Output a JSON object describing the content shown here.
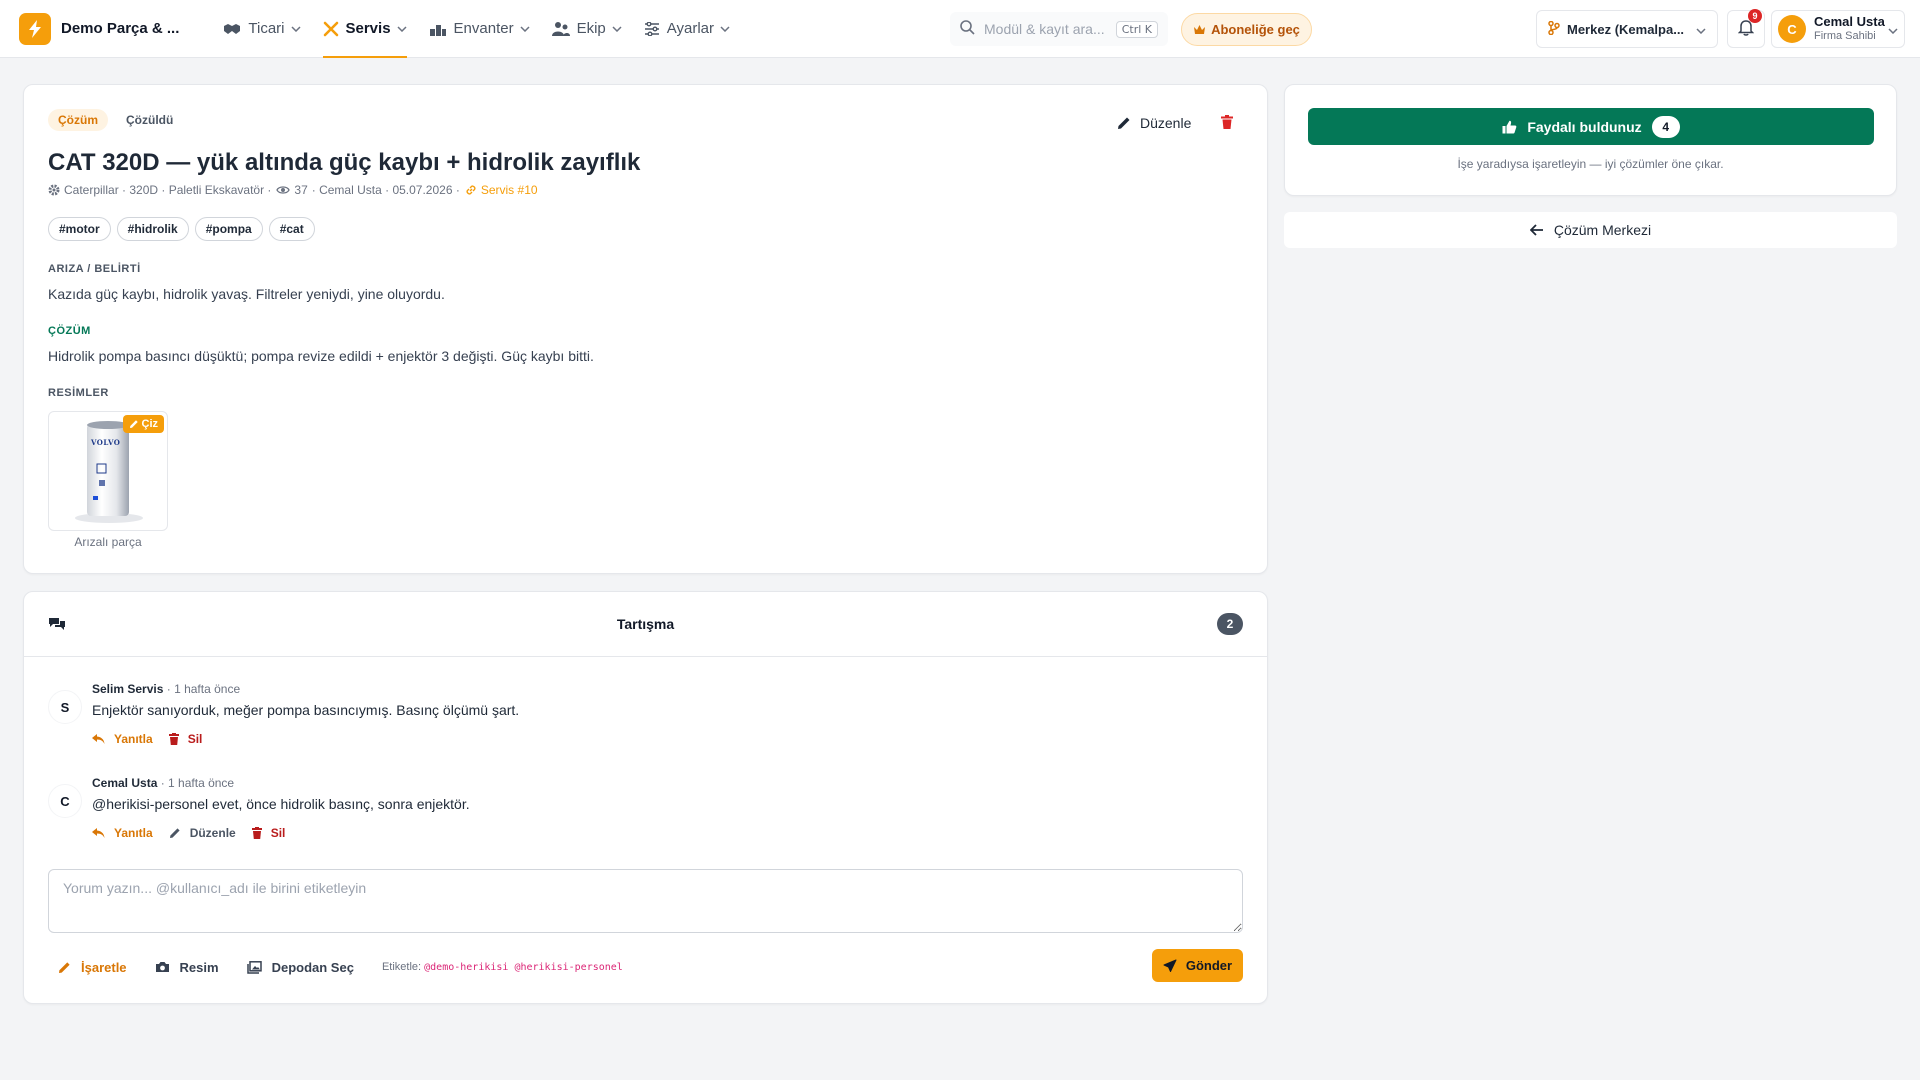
{
  "brand": {
    "name": "Demo Parça & ..."
  },
  "nav": {
    "items": [
      {
        "label": "Ticari",
        "icon": "handshake-icon"
      },
      {
        "label": "Servis",
        "icon": "tools-icon",
        "active": true
      },
      {
        "label": "Envanter",
        "icon": "warehouse-icon"
      },
      {
        "label": "Ekip",
        "icon": "users-icon"
      },
      {
        "label": "Ayarlar",
        "icon": "sliders-icon"
      }
    ]
  },
  "search": {
    "placeholder": "Modül & kayıt ara...",
    "shortcut": "Ctrl K"
  },
  "subscribe": {
    "label": "Aboneliğe geç"
  },
  "branch": {
    "label": "Merkez (Kemalpa..."
  },
  "notifications": {
    "count": "9"
  },
  "user": {
    "initial": "C",
    "name": "Cemal Usta",
    "role": "Firma Sahibi"
  },
  "solution": {
    "type_badge": "Çözüm",
    "status_badge": "Çözüldü",
    "edit_label": "Düzenle",
    "title": "CAT 320D — yük altında güç kaybı + hidrolik zayıflık",
    "meta": {
      "machine": "Caterpillar · 320D · Paletli Ekskavatör ·",
      "views": "37",
      "author_date": "· Cemal Usta · 05.07.2026 ·",
      "service_link": "Servis #10"
    },
    "hashtags": [
      "#motor",
      "#hidrolik",
      "#pompa",
      "#cat"
    ],
    "symptom_label": "ARIZA / BELİRTİ",
    "symptom_text": "Kazıda güç kaybı, hidrolik yavaş. Filtreler yeniydi, yine oluyordu.",
    "solution_label": "ÇÖZÜM",
    "solution_text": "Hidrolik pompa basıncı düşüktü; pompa revize edildi + enjektör 3 değişti. Güç kaybı bitti.",
    "images_label": "RESİMLER",
    "image": {
      "draw_label": "Çiz",
      "caption": "Arızalı parça",
      "brand_text": "VOLVO"
    }
  },
  "discussion": {
    "title": "Tartışma",
    "count": "2",
    "comments": [
      {
        "initial": "S",
        "author": "Selim Servis",
        "time": "· 1 hafta önce",
        "text": "Enjektör sanıyorduk, meğer pompa basıncıymış. Basınç ölçümü şart.",
        "reply_label": "Yanıtla",
        "delete_label": "Sil"
      },
      {
        "initial": "C",
        "author": "Cemal Usta",
        "time": "· 1 hafta önce",
        "text": "@herikisi-personel evet, önce hidrolik basınç, sonra enjektör.",
        "reply_label": "Yanıtla",
        "edit_label": "Düzenle",
        "delete_label": "Sil"
      }
    ],
    "input_placeholder": "Yorum yazın... @kullanıcı_adı ile birini etiketleyin",
    "tools": {
      "mark": "İşaretle",
      "image": "Resim",
      "from_depot": "Depodan Seç"
    },
    "tag_hint_label": "Etiketle:",
    "tag_hint_users": "@demo-herikisi @herikisi-personel",
    "send_label": "Gönder"
  },
  "helpful": {
    "label": "Faydalı buldunuz",
    "count": "4",
    "hint": "İşe yaradıysa işaretleyin — iyi çözümler öne çıkar."
  },
  "back_link": {
    "label": "Çözüm Merkezi"
  },
  "colors": {
    "accent": "#f59e0b",
    "success": "#047857",
    "danger": "#dc2626"
  }
}
